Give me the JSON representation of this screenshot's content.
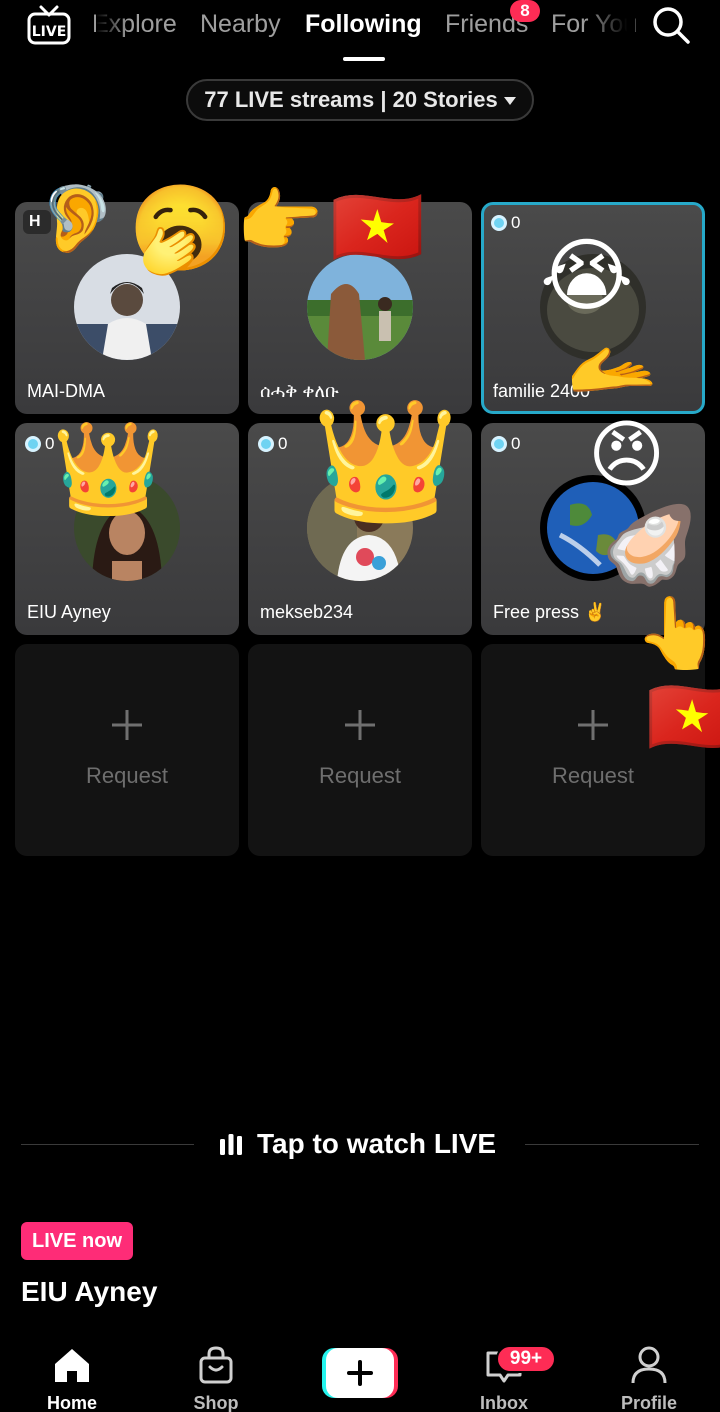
{
  "topnav": {
    "logo_text": "LIVE",
    "tabs": [
      {
        "label": "Explore"
      },
      {
        "label": "Nearby"
      },
      {
        "label": "Following",
        "active": true
      },
      {
        "label": "Friends",
        "badge": "8"
      },
      {
        "label": "For You"
      }
    ],
    "search_icon": "search-icon"
  },
  "counter": {
    "label": "77 LIVE streams | 20 Stories"
  },
  "cards": [
    {
      "name": "MAI-DMA",
      "badge": "H"
    },
    {
      "name": "ሰሓቅ ቀለቡ"
    },
    {
      "name": "familie 2400",
      "viewers": "0",
      "selected": true
    },
    {
      "name": "EIU Ayney",
      "viewers": "0"
    },
    {
      "name": "mekseb234",
      "viewers": "0"
    },
    {
      "name": "Free press ✌️",
      "viewers": "0"
    }
  ],
  "requests": [
    {
      "label": "Request"
    },
    {
      "label": "Request"
    },
    {
      "label": "Request"
    }
  ],
  "stickers": [
    "🦻",
    "🥱",
    "👉",
    "🇻🇳",
    "😭",
    "🫴",
    "👑",
    "👑",
    "😠",
    "🦪",
    "👆",
    "🇻🇳"
  ],
  "tap_to_watch": {
    "label": "Tap to watch LIVE"
  },
  "live_now": {
    "badge": "LIVE now",
    "name": "EIU Ayney"
  },
  "bottomnav": {
    "items": [
      {
        "label": "Home",
        "icon": "home-icon",
        "active": true
      },
      {
        "label": "Shop",
        "icon": "shop-bag-icon"
      },
      {
        "label": "",
        "icon": "plus-icon"
      },
      {
        "label": "Inbox",
        "icon": "inbox-icon",
        "badge": "99+"
      },
      {
        "label": "Profile",
        "icon": "person-icon"
      }
    ]
  },
  "colors": {
    "accent": "#fe2c55",
    "selected_border": "#27a9c9",
    "live_badge": "#fe2c77"
  }
}
